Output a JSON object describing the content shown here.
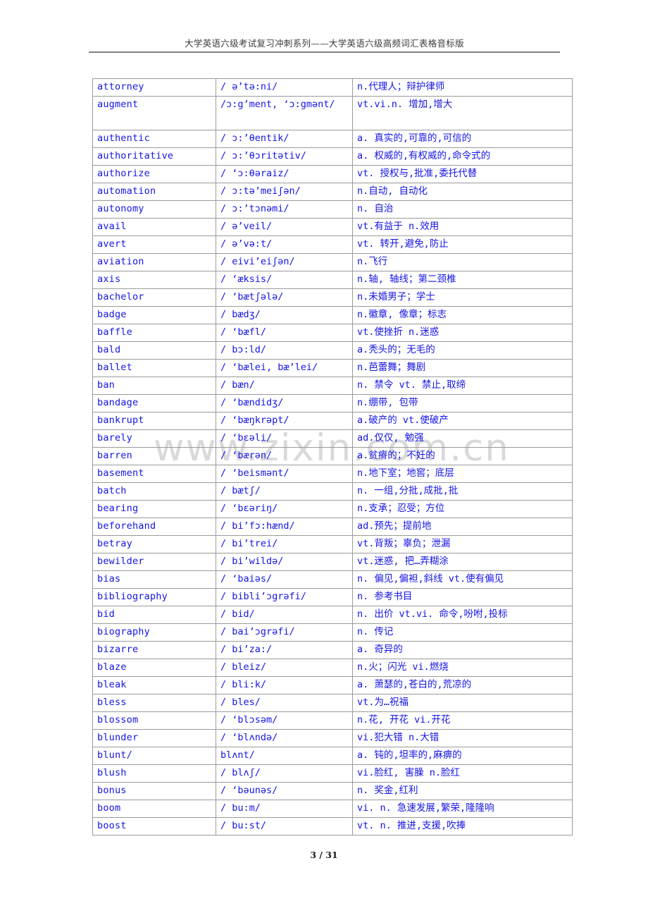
{
  "header": {
    "title": "大学英语六级考试复习冲刺系列——大学英语六级高频词汇表格音标版"
  },
  "watermark": {
    "text": "www.zixin.com.cn"
  },
  "footer": {
    "page_label": "3 / 31"
  },
  "colors": {
    "word_blue": "#1414e6",
    "definition_blue": "#1414e6",
    "ipa_black": "#000000",
    "border_gray": "#9a9a9a",
    "header_gray": "#3a3a3a",
    "watermark_gray": "#d9d9d9"
  },
  "table": {
    "rows": [
      {
        "word": "attorney",
        "ipa": "/ ə’tə:ni/",
        "definition": "n.代理人；辩护律师",
        "tall": false
      },
      {
        "word": "augment",
        "ipa": "/ɔ:g’ment, ‘ɔ:gmənt/",
        "definition": "vt.vi.n. 增加,增大",
        "tall": true
      },
      {
        "word": "authentic",
        "ipa": "/ ɔ:’θentik/",
        "definition": "a. 真实的,可靠的,可信的",
        "tall": false
      },
      {
        "word": "authoritative",
        "ipa": "/ ɔ:’θɔritətiv/",
        "definition": "a. 权威的,有权威的,命令式的",
        "tall": false
      },
      {
        "word": "authorize",
        "ipa": "/ ‘ɔ:θəraiz/",
        "definition": "vt. 授权与,批准,委托代替",
        "tall": false
      },
      {
        "word": "automation",
        "ipa": "/ ɔ:tə’meiʃən/",
        "definition": "n.自动, 自动化",
        "tall": false
      },
      {
        "word": "autonomy",
        "ipa": "/ ɔ:’tɔnəmi/",
        "definition": "n. 自治",
        "tall": false
      },
      {
        "word": "avail",
        "ipa": "/ ə’veil/",
        "definition": "vt.有益于 n.效用",
        "tall": false
      },
      {
        "word": "avert",
        "ipa": "/ ə’və:t/",
        "definition": "vt. 转开,避免,防止",
        "tall": false
      },
      {
        "word": "aviation",
        "ipa": "/ eivi’eiʃən/",
        "definition": "n.飞行",
        "tall": false
      },
      {
        "word": "axis",
        "ipa": "/ ‘æksis/",
        "definition": "n.轴, 轴线；第二颈椎",
        "tall": false
      },
      {
        "word": "bachelor",
        "ipa": "/ ‘bætʃələ/",
        "definition": "n.未婚男子；学士",
        "tall": false
      },
      {
        "word": "badge",
        "ipa": "/ bædʒ/",
        "definition": "n.徽章, 像章；标志",
        "tall": false
      },
      {
        "word": "baffle",
        "ipa": "/ ‘bæfl/",
        "definition": "vt.使挫折 n.迷惑",
        "tall": false
      },
      {
        "word": "bald",
        "ipa": "/ bɔ:ld/",
        "definition": "a.秃头的；无毛的",
        "tall": false
      },
      {
        "word": "ballet",
        "ipa": "/ ‘bælei, bæ’lei/",
        "definition": "n.芭蕾舞；舞剧",
        "tall": false
      },
      {
        "word": "ban",
        "ipa": "/ bæn/",
        "definition": "n. 禁令 vt. 禁止,取缔",
        "tall": false
      },
      {
        "word": "bandage",
        "ipa": "/ ‘bændidʒ/",
        "definition": "n.绷带, 包带",
        "tall": false
      },
      {
        "word": "bankrupt",
        "ipa": "/ ‘bæŋkrəpt/",
        "definition": "a.破产的 vt.使破产",
        "tall": false
      },
      {
        "word": "barely",
        "ipa": "/ ‘bɛəli/",
        "definition": "ad.仅仅, 勉强",
        "tall": false
      },
      {
        "word": "barren",
        "ipa": "/ ‘bærən/",
        "definition": "a.贫瘠的；不妊的",
        "tall": false
      },
      {
        "word": "basement",
        "ipa": "/ ‘beismənt/",
        "definition": "n.地下室；地窖；底层",
        "tall": false
      },
      {
        "word": "batch",
        "ipa": "/ bætʃ/",
        "definition": "n. 一组,分批,成批,批",
        "tall": false
      },
      {
        "word": "bearing",
        "ipa": "/ ‘bɛəriŋ/",
        "definition": "n.支承；忍受；方位",
        "tall": false
      },
      {
        "word": "beforehand",
        "ipa": "/ bi’fɔ:hænd/",
        "definition": "ad.预先；提前地",
        "tall": false
      },
      {
        "word": "betray",
        "ipa": "/ bi’trei/",
        "definition": "vt.背叛；辜负；泄漏",
        "tall": false
      },
      {
        "word": "bewilder",
        "ipa": "/ bi’wildə/",
        "definition": "vt.迷惑, 把…弄糊涂",
        "tall": false
      },
      {
        "word": "bias",
        "ipa": "/ ‘baiəs/",
        "definition": "n. 偏见,偏袒,斜线 vt.使有偏见",
        "tall": false
      },
      {
        "word": "bibliography",
        "ipa": "/ bibli’ɔgrəfi/",
        "definition": "n. 参考书目",
        "tall": false
      },
      {
        "word": "bid",
        "ipa": "/ bid/",
        "definition": "n. 出价 vt.vi. 命令,吩咐,投标",
        "tall": false
      },
      {
        "word": "biography",
        "ipa": "/ bai’ɔgrəfi/",
        "definition": "n. 传记",
        "tall": false
      },
      {
        "word": "bizarre",
        "ipa": "/ bi’za:/",
        "definition": "a. 奇异的",
        "tall": false
      },
      {
        "word": "blaze",
        "ipa": "/ bleiz/",
        "definition": "n.火；闪光 vi.燃烧",
        "tall": false
      },
      {
        "word": "bleak",
        "ipa": "/ bli:k/",
        "definition": "a. 萧瑟的,苍白的,荒凉的",
        "tall": false
      },
      {
        "word": "bless",
        "ipa": "/ bles/",
        "definition": "vt.为…祝福",
        "tall": false
      },
      {
        "word": "blossom",
        "ipa": "/ ‘blɔsəm/",
        "definition": "n.花, 开花 vi.开花",
        "tall": false
      },
      {
        "word": "blunder",
        "ipa": "/ ‘blʌndə/",
        "definition": "vi.犯大错 n.大错",
        "tall": false
      },
      {
        "word": "blunt/",
        "ipa": "blʌnt/",
        "definition": "a. 钝的,坦率的,麻痹的",
        "tall": false
      },
      {
        "word": "blush",
        "ipa": "/ blʌʃ/",
        "definition": "vi.脸红, 害臊 n.脸红",
        "tall": false
      },
      {
        "word": "bonus",
        "ipa": "/ ‘bəunəs/",
        "definition": "n. 奖金,红利",
        "tall": false
      },
      {
        "word": "boom",
        "ipa": "/ bu:m/",
        "definition": "vi. n. 急速发展,繁荣,隆隆响",
        "tall": false
      },
      {
        "word": "boost",
        "ipa": "/ bu:st/",
        "definition": "vt. n. 推进,支援,吹捧",
        "tall": false
      }
    ]
  }
}
